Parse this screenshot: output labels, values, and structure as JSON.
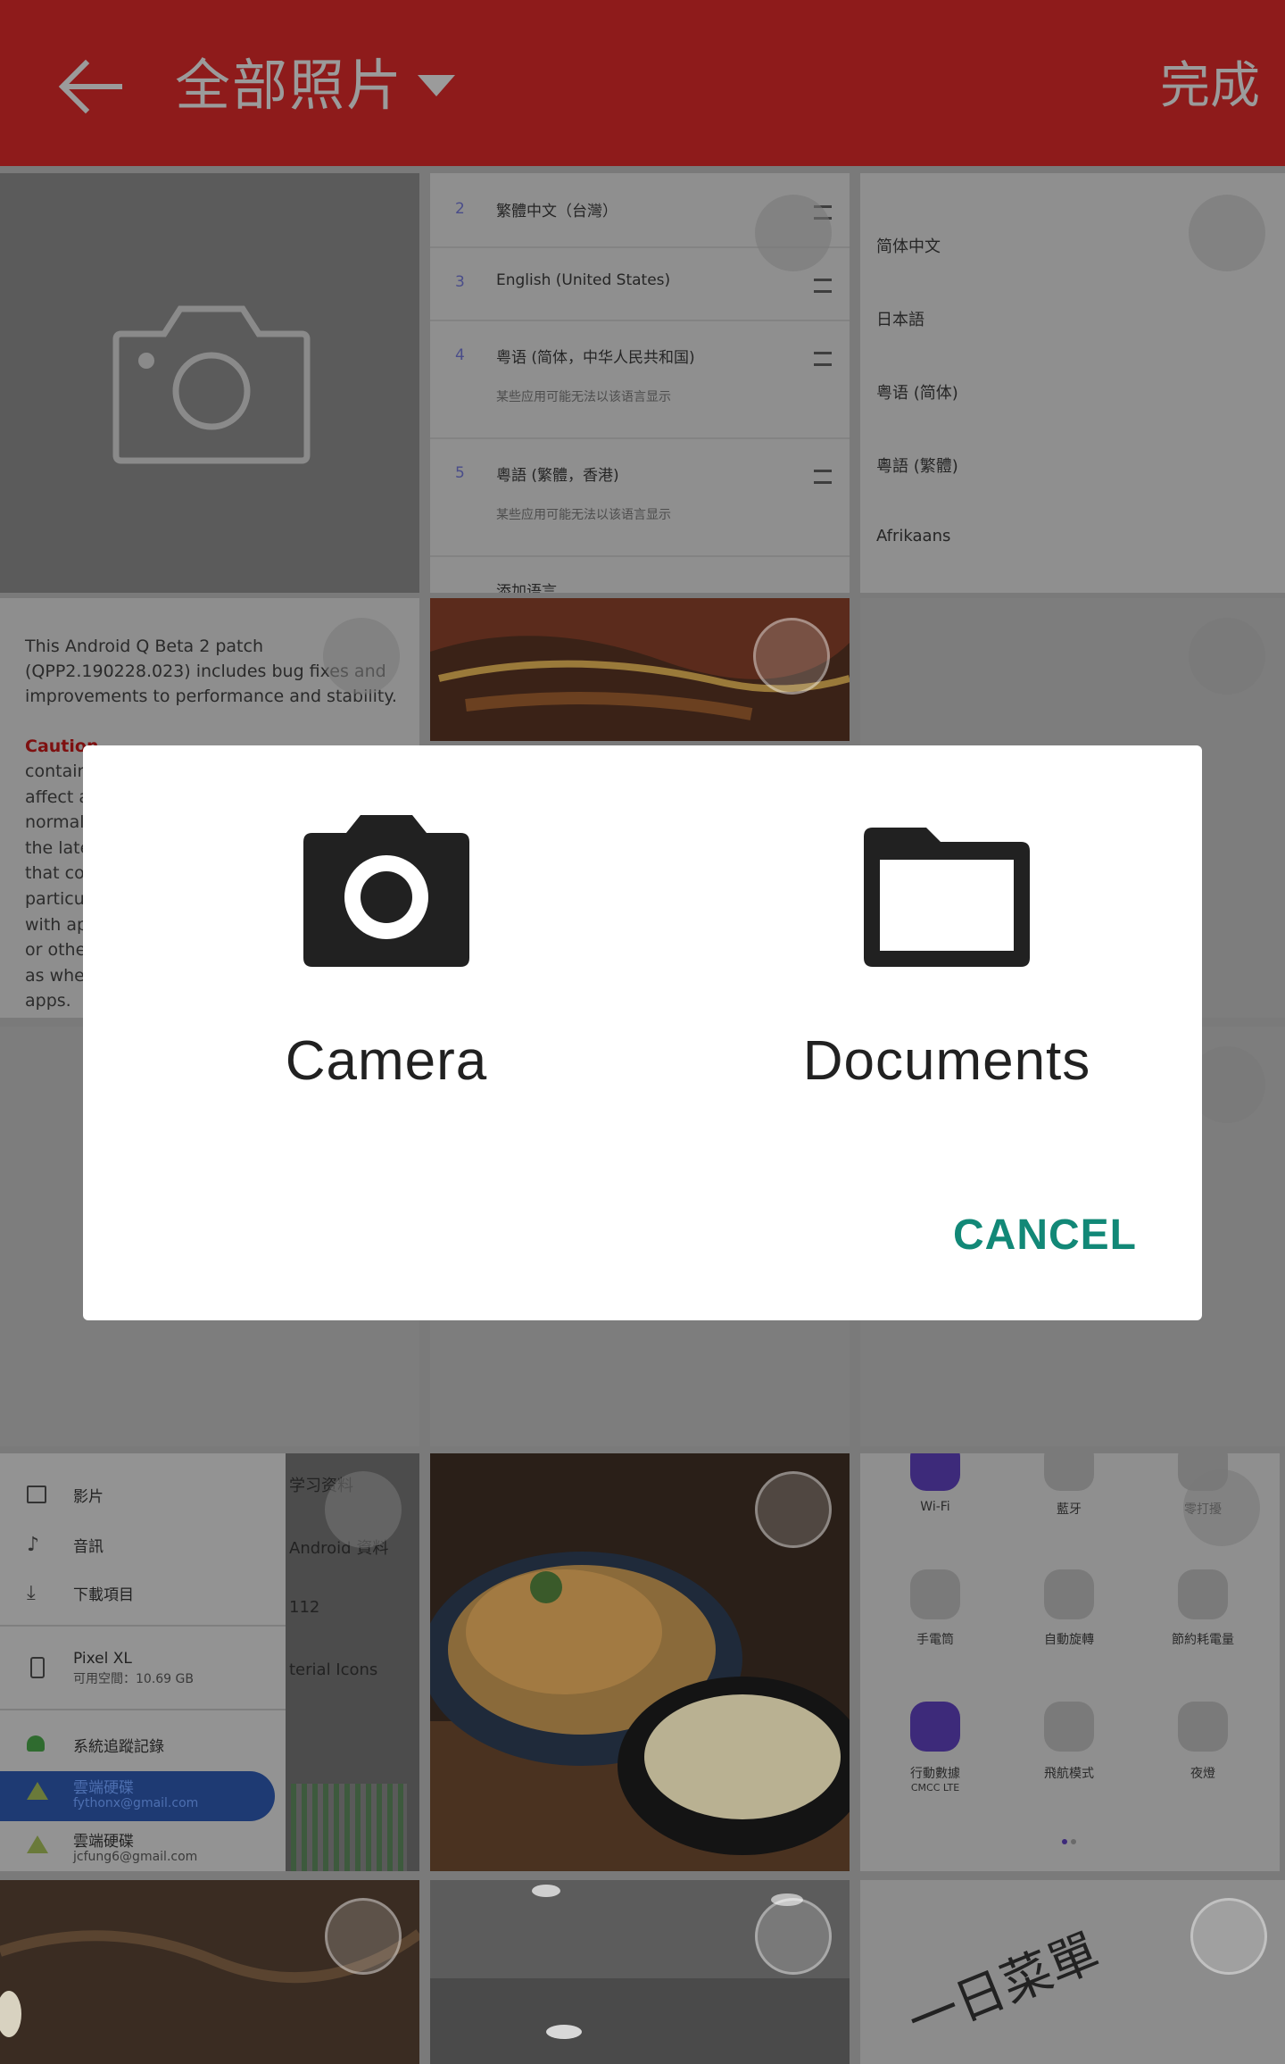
{
  "app_bar": {
    "title": "全部照片",
    "done_label": "完成"
  },
  "grid": {
    "language_list": [
      {
        "num": "2",
        "name": "繁體中文（台灣）",
        "sub": ""
      },
      {
        "num": "3",
        "name": "English (United States)",
        "sub": ""
      },
      {
        "num": "4",
        "name": "粤语 (简体，中华人民共和国)",
        "sub": "某些应用可能无法以该语言显示"
      },
      {
        "num": "5",
        "name": "粵語 (繁體，香港)",
        "sub": "某些应用可能无法以该语言显示"
      },
      {
        "num": "",
        "name": "添加语言",
        "sub": ""
      }
    ],
    "language_list_2": [
      "简体中文",
      "日本語",
      "粤语 (简体)",
      "粵語 (繁體)",
      "Afrikaans"
    ],
    "beta_intro": "This Android Q Beta 2 patch (QPP2.190228.023) includes bug fixes and improvements to performance and stability.",
    "beta_caution": "Caution",
    "beta_lines": [
      "contain",
      "affect a",
      "normal",
      "the late",
      "that co",
      "particul",
      "with ap",
      "or othe",
      "as whe",
      "apps."
    ],
    "drawer_items": [
      {
        "label": "影片",
        "sub": ""
      },
      {
        "label": "音訊",
        "sub": ""
      },
      {
        "label": "下載項目",
        "sub": ""
      },
      {
        "label": "Pixel XL",
        "sub": "可用空間：10.69 GB"
      },
      {
        "label": "系統追蹤記錄",
        "sub": ""
      },
      {
        "label": "雲端硬碟",
        "sub": "fythonx@gmail.com"
      },
      {
        "label": "雲端硬碟",
        "sub": "jcfung6@gmail.com"
      }
    ],
    "drawer_right": [
      "学习资料",
      "Android 資料",
      "112",
      "terial Icons"
    ],
    "quick_settings": [
      {
        "label": "Wi-Fi",
        "sub": ""
      },
      {
        "label": "藍牙",
        "sub": ""
      },
      {
        "label": "零打擾",
        "sub": ""
      },
      {
        "label": "手電筒",
        "sub": ""
      },
      {
        "label": "自動旋轉",
        "sub": ""
      },
      {
        "label": "節約耗電量",
        "sub": ""
      },
      {
        "label": "行動數據",
        "sub": "CMCC LTE"
      },
      {
        "label": "飛航模式",
        "sub": ""
      },
      {
        "label": "夜燈",
        "sub": ""
      }
    ],
    "receipt_text": "一日菜單"
  },
  "dialog": {
    "options": [
      {
        "label": "Camera",
        "icon": "camera-icon"
      },
      {
        "label": "Documents",
        "icon": "folder-icon"
      }
    ],
    "cancel_label": "CANCEL",
    "accent_color": "#128877"
  }
}
